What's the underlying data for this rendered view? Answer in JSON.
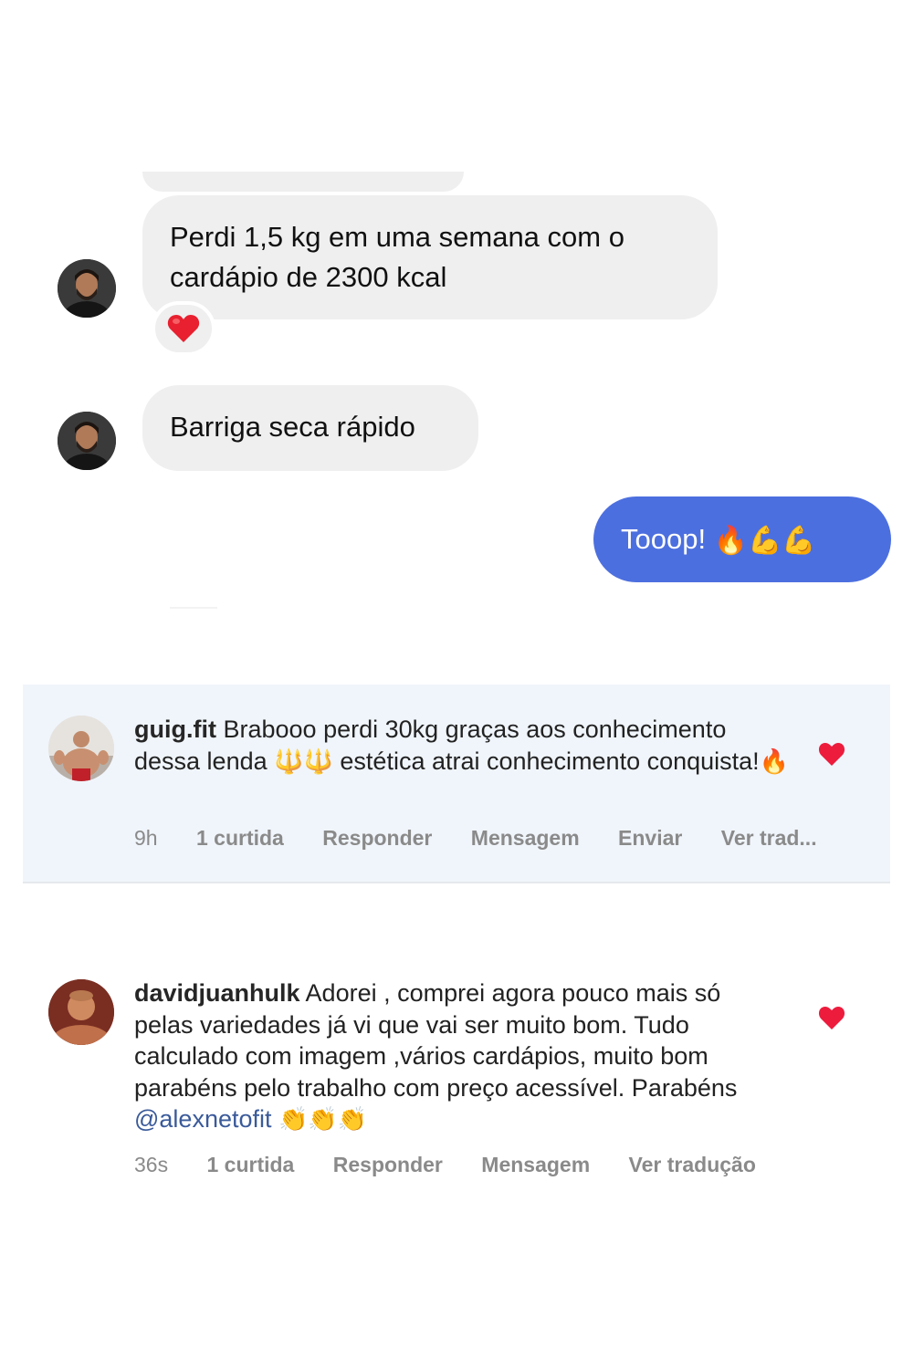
{
  "chat": {
    "messages": [
      {
        "text": "Perdi 1,5 kg em uma semana com o cardápio de 2300 kcal",
        "reaction": "❤️"
      },
      {
        "text": "Barriga seca rápido"
      }
    ],
    "sent": {
      "text": "Tooop!",
      "emoji": "🔥💪💪"
    }
  },
  "comments": [
    {
      "username": "guig.fit",
      "text_before": "Brabooo perdi 30kg graças aos conhecimento dessa lenda",
      "emoji_mid": "🔱🔱",
      "text_after": "estética atrai conhecimento conquista!",
      "emoji_end": "🔥",
      "time": "9h",
      "likes": "1 curtida",
      "reply": "Responder",
      "message": "Mensagem",
      "send": "Enviar",
      "translate": "Ver trad..."
    },
    {
      "username": "davidjuanhulk",
      "text_before": "Adorei , comprei agora pouco mais só pelas variedades já vi que vai ser muito bom. Tudo calculado com imagem ,vários cardápios, muito bom parabéns pelo trabalho com preço acessível. Parabéns",
      "mention": "@alexnetofit",
      "emoji_end": "👏👏👏",
      "time": "36s",
      "likes": "1 curtida",
      "reply": "Responder",
      "message": "Mensagem",
      "translate": "Ver tradução"
    }
  ],
  "colors": {
    "sent_bubble": "#4c6fdf",
    "received_bubble": "#efefef",
    "highlight": "#f0f5fb",
    "like_heart": "#ed1c3d"
  }
}
